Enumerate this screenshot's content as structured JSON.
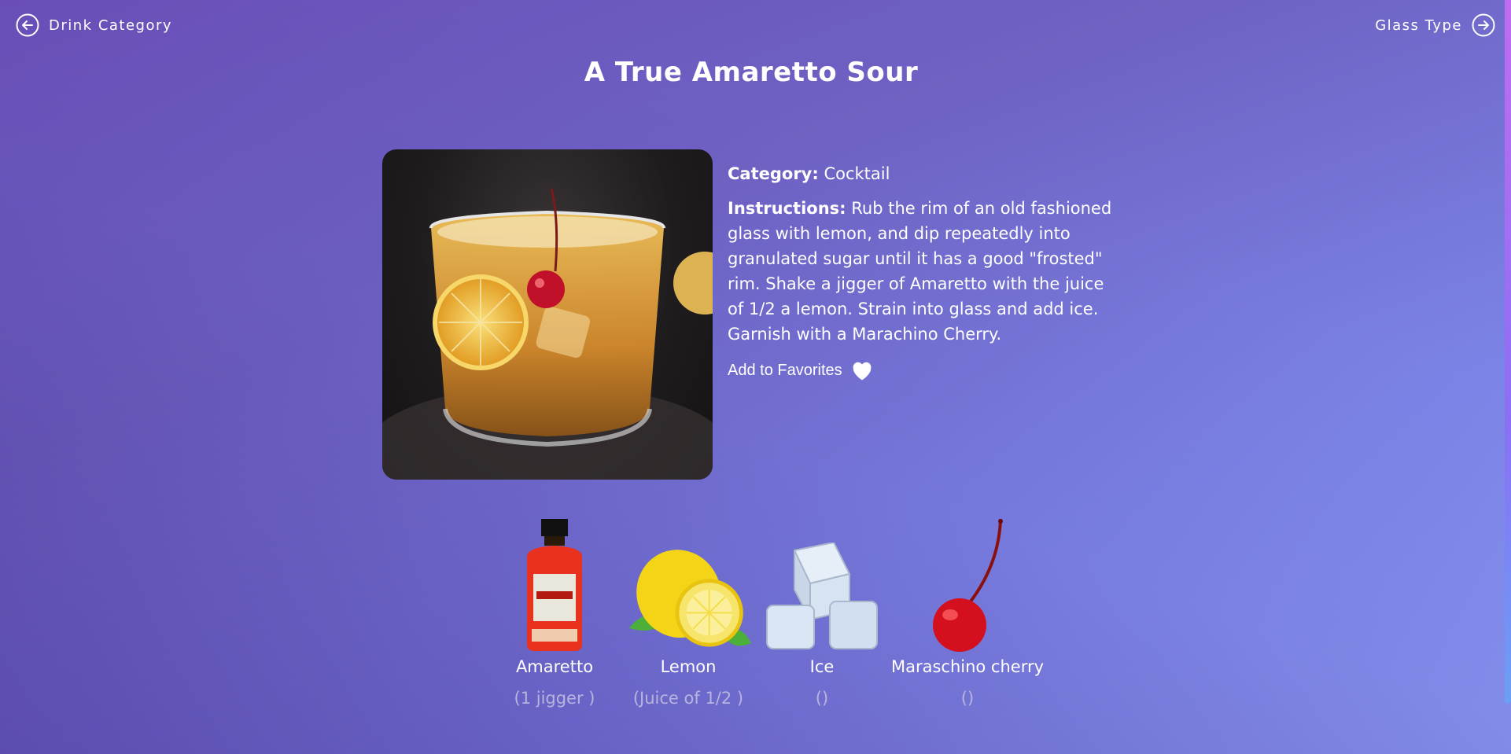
{
  "nav": {
    "prev_label": "Drink Category",
    "next_label": "Glass Type"
  },
  "drink": {
    "title": "A True Amaretto Sour",
    "category_label": "Category:",
    "category_value": "Cocktail",
    "instructions_label": "Instructions:",
    "instructions_value": "Rub the rim of an old fashioned glass with lemon, and dip repeatedly into granulated sugar until it has a good \"frosted\" rim. Shake a jigger of Amaretto with the juice of 1/2 a lemon. Strain into glass and add ice. Garnish with a Marachino Cherry.",
    "favorite_label": "Add to Favorites"
  },
  "ingredients": [
    {
      "name": "Amaretto",
      "measure": "(1 jigger )",
      "icon": "amaretto-bottle"
    },
    {
      "name": "Lemon",
      "measure": "(Juice of 1/2 )",
      "icon": "lemon"
    },
    {
      "name": "Ice",
      "measure": "()",
      "icon": "ice-cubes"
    },
    {
      "name": "Maraschino cherry",
      "measure": "()",
      "icon": "cherry"
    }
  ],
  "colors": {
    "bg_start": "#6a4fb8",
    "bg_end": "#8a9af5",
    "text": "#ffffff",
    "measure_text": "#b8b4dc"
  }
}
